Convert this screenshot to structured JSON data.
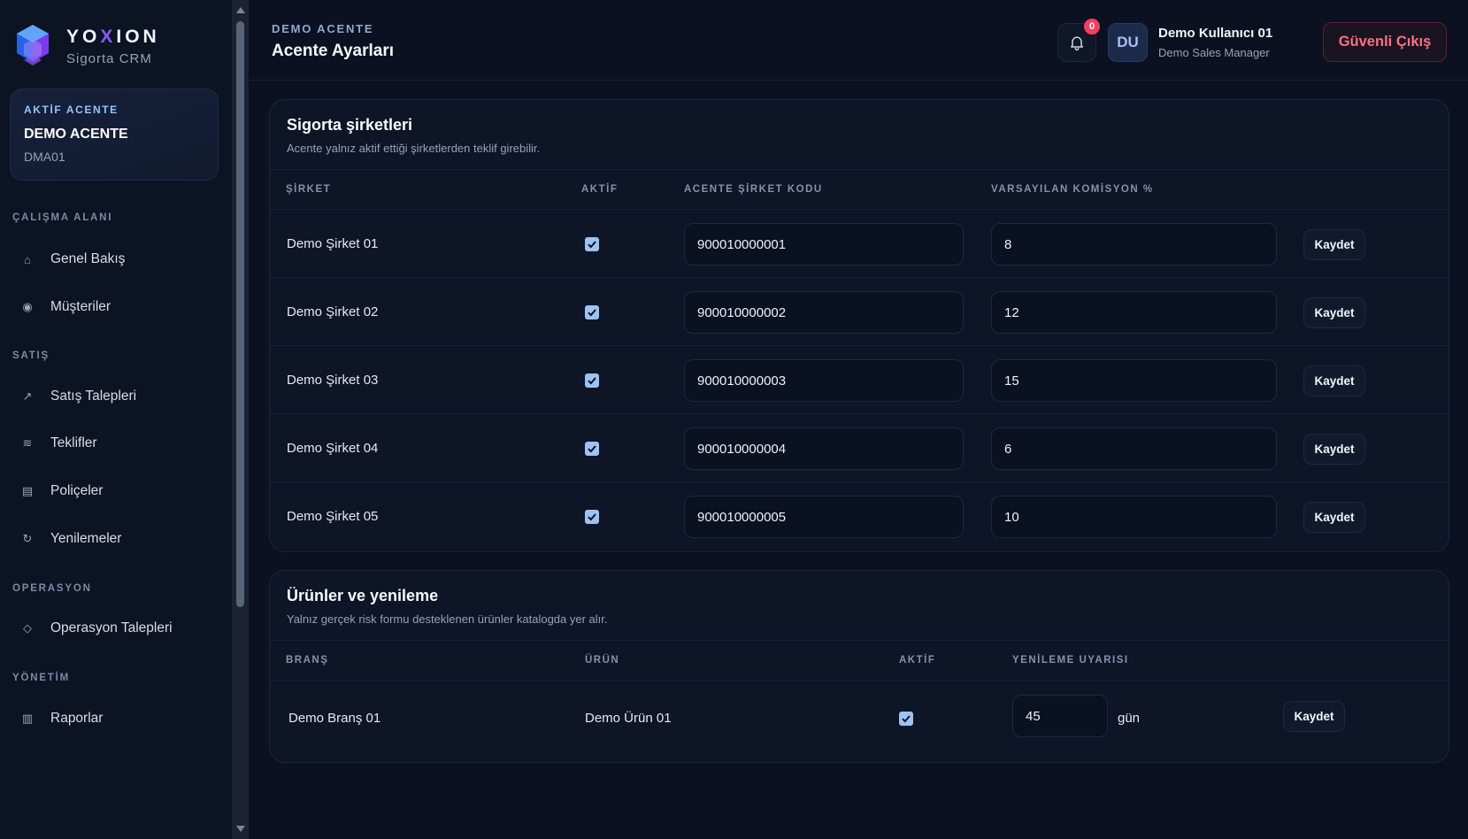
{
  "brand": {
    "name_pre": "YO",
    "name_x": "X",
    "name_post": "ION",
    "subtitle": "Sigorta CRM"
  },
  "agency": {
    "tag": "AKTİF ACENTE",
    "name": "DEMO ACENTE",
    "code": "DMA01"
  },
  "nav": {
    "sections": [
      "ÇALIŞMA ALANI",
      "SATIŞ",
      "OPERASYON",
      "YÖNETİM"
    ],
    "items": [
      {
        "label": "Genel Bakış",
        "icon": "home-icon"
      },
      {
        "label": "Müşteriler",
        "icon": "customers-icon"
      },
      {
        "label": "Satış Talepleri",
        "icon": "trend-arrow-icon"
      },
      {
        "label": "Teklifler",
        "icon": "offers-icon"
      },
      {
        "label": "Poliçeler",
        "icon": "policy-icon"
      },
      {
        "label": "Yenilemeler",
        "icon": "refresh-icon"
      },
      {
        "label": "Operasyon Talepleri",
        "icon": "diamond-icon"
      },
      {
        "label": "Raporlar",
        "icon": "reports-icon"
      }
    ]
  },
  "header": {
    "breadcrumb": "DEMO ACENTE",
    "title": "Acente Ayarları",
    "notification_count": "0",
    "avatar_initials": "DU",
    "user_name": "Demo Kullanıcı 01",
    "user_role": "Demo Sales Manager",
    "logout_label": "Güvenli Çıkış"
  },
  "companies_card": {
    "title": "Sigorta şirketleri",
    "subtitle": "Acente yalnız aktif ettiği şirketlerden teklif girebilir.",
    "columns": [
      "ŞİRKET",
      "AKTİF",
      "ACENTE ŞİRKET KODU",
      "VARSAYILAN KOMİSYON %"
    ],
    "rows": [
      {
        "company": "Demo Şirket 01",
        "active": true,
        "code": "900010000001",
        "commission": "8",
        "save": "Kaydet"
      },
      {
        "company": "Demo Şirket 02",
        "active": true,
        "code": "900010000002",
        "commission": "12",
        "save": "Kaydet"
      },
      {
        "company": "Demo Şirket 03",
        "active": true,
        "code": "900010000003",
        "commission": "15",
        "save": "Kaydet"
      },
      {
        "company": "Demo Şirket 04",
        "active": true,
        "code": "900010000004",
        "commission": "6",
        "save": "Kaydet"
      },
      {
        "company": "Demo Şirket 05",
        "active": true,
        "code": "900010000005",
        "commission": "10",
        "save": "Kaydet"
      }
    ]
  },
  "products_card": {
    "title": "Ürünler ve yenileme",
    "subtitle": "Yalnız gerçek risk formu desteklenen ürünler katalogda yer alır.",
    "columns": [
      "BRANŞ",
      "ÜRÜN",
      "AKTİF",
      "YENİLEME UYARISI"
    ],
    "rows": [
      {
        "branch": "Demo Branş 01",
        "product": "Demo Ürün 01",
        "active": true,
        "renewal_days": "45",
        "unit": "gün",
        "save": "Kaydet"
      }
    ]
  },
  "colors": {
    "background": "#0b1120",
    "accent": "#8b5cf6",
    "danger": "#fb7185",
    "check": "#9cc3f2"
  }
}
